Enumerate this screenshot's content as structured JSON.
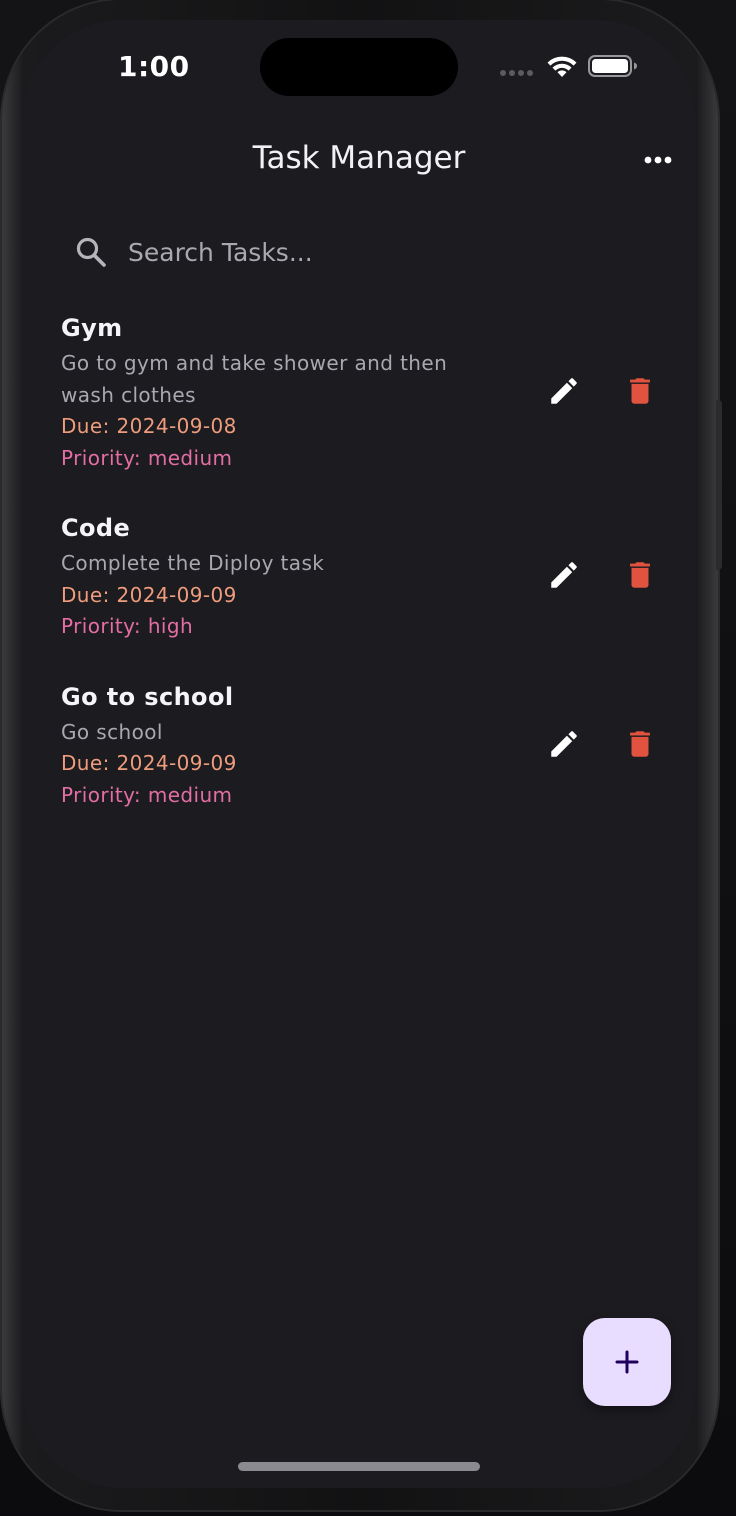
{
  "status_bar": {
    "time": "1:00"
  },
  "app_bar": {
    "title": "Task Manager",
    "menu_icon": "more-horizontal-icon"
  },
  "search": {
    "placeholder": "Search Tasks...",
    "value": "",
    "icon": "search-icon"
  },
  "tasks": [
    {
      "title": "Gym",
      "description": "Go to gym and take shower and then wash clothes",
      "due": "Due: 2024-09-08",
      "priority": "Priority: medium"
    },
    {
      "title": "Code",
      "description": "Complete the Diploy task",
      "due": "Due: 2024-09-09",
      "priority": "Priority: high"
    },
    {
      "title": "Go to school",
      "description": "Go school",
      "due": "Due: 2024-09-09",
      "priority": "Priority: medium"
    }
  ],
  "actions": {
    "edit_icon": "pencil-icon",
    "delete_icon": "trash-icon"
  },
  "fab": {
    "icon": "plus-icon"
  },
  "colors": {
    "background": "#1b1b20",
    "title_text": "#f5f5f7",
    "description_text": "#a8a8b0",
    "due_text": "#ef9c7c",
    "priority_text": "#e26ea3",
    "delete_icon": "#e0533f",
    "edit_icon": "#ffffff",
    "fab_background": "#e9ddff",
    "fab_icon": "#21005d"
  }
}
